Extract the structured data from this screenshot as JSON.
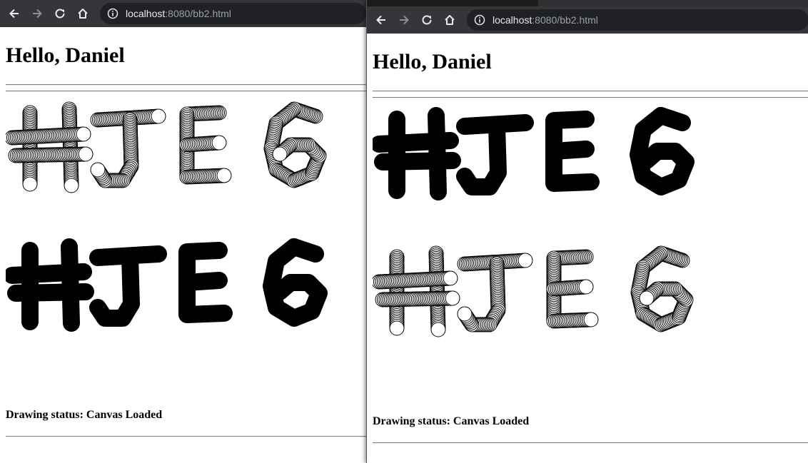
{
  "windows": [
    {
      "url_host": "localhost",
      "url_path": ":8080/bb2.html",
      "heading": "Hello, Daniel",
      "status_label": "Drawing status:",
      "status_value": "Canvas Loaded",
      "upper_text": "#JE6",
      "upper_style": "outline-circles",
      "lower_text": "#JE6",
      "lower_style": "solid"
    },
    {
      "url_host": "localhost",
      "url_path": ":8080/bb2.html",
      "heading": "Hello, Daniel",
      "status_label": "Drawing status:",
      "status_value": "Canvas Loaded",
      "upper_text": "#JE6",
      "upper_style": "solid",
      "lower_text": "#JE6",
      "lower_style": "outline-circles"
    }
  ],
  "icons": {
    "back": "arrow-left-icon",
    "forward": "arrow-right-icon",
    "reload": "reload-icon",
    "home": "home-icon",
    "site_info": "info-icon"
  },
  "colors": {
    "toolbar": "#35363a",
    "omnibox": "#202124",
    "ink": "#000000",
    "circle_fill": "#ffffff"
  }
}
